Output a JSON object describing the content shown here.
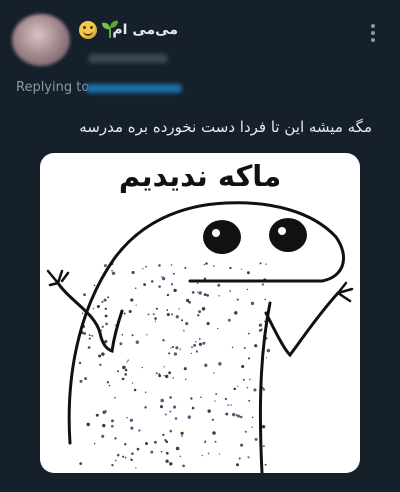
{
  "tweet": {
    "display_name": "می‌می ام",
    "replying_prefix": "Replying to",
    "text": "مگه میشه این تا فردا دست نخورده بره مدرسه",
    "media": {
      "caption": "ماکه ندیدیم"
    }
  },
  "icons": {
    "name_emojis": [
      "smiling-face-icon",
      "seedling-icon"
    ],
    "menu": "more-vertical-icon"
  },
  "colors": {
    "background": "#15202b",
    "secondary_text": "#8b98a5",
    "primary_text": "#e7e9ea"
  }
}
